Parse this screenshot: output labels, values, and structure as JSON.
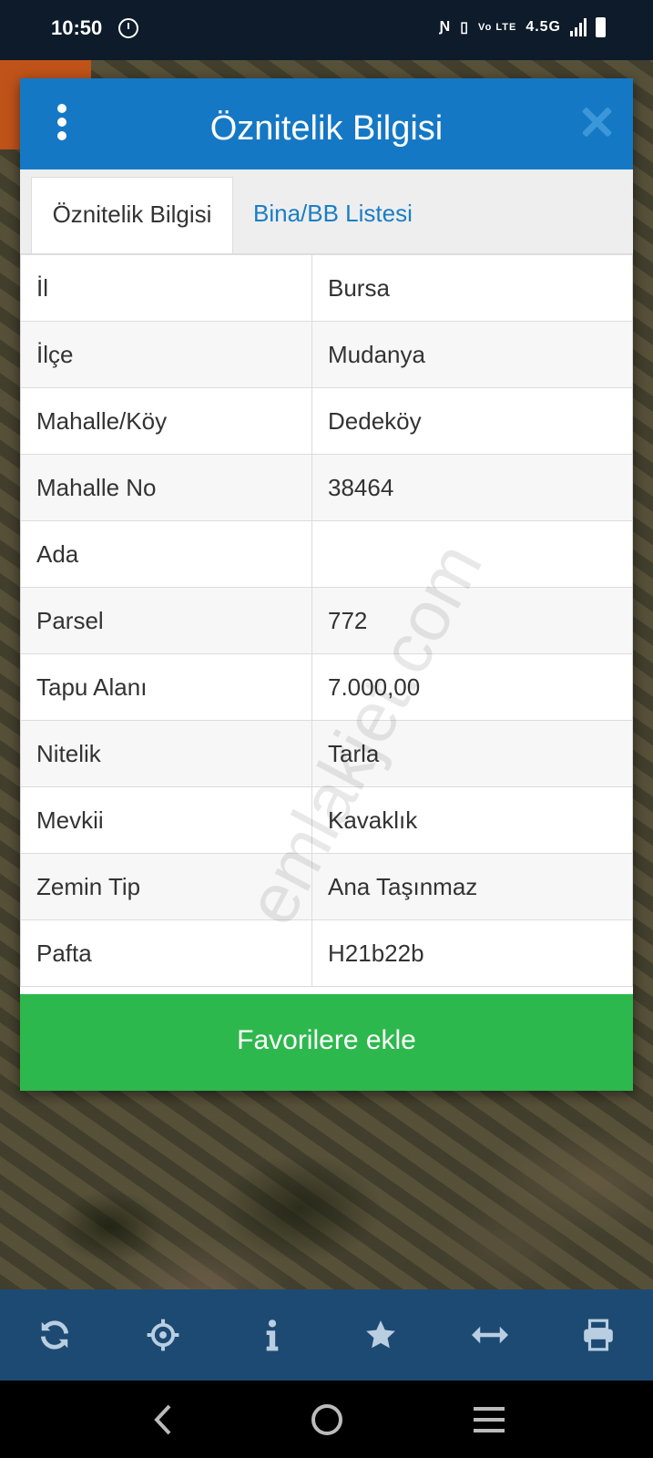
{
  "status": {
    "time": "10:50",
    "network": "4.5G",
    "volte": "Vo LTE"
  },
  "dialog": {
    "title": "Öznitelik Bilgisi",
    "tabs": [
      "Öznitelik Bilgisi",
      "Bina/BB Listesi"
    ],
    "rows": [
      {
        "key": "İl",
        "value": "Bursa"
      },
      {
        "key": "İlçe",
        "value": "Mudanya"
      },
      {
        "key": "Mahalle/Köy",
        "value": "Dedeköy"
      },
      {
        "key": "Mahalle No",
        "value": "38464"
      },
      {
        "key": "Ada",
        "value": ""
      },
      {
        "key": "Parsel",
        "value": "772"
      },
      {
        "key": "Tapu Alanı",
        "value": "7.000,00"
      },
      {
        "key": "Nitelik",
        "value": "Tarla"
      },
      {
        "key": "Mevkii",
        "value": "Kavaklık"
      },
      {
        "key": "Zemin Tip",
        "value": "Ana Taşınmaz"
      },
      {
        "key": "Pafta",
        "value": "H21b22b"
      }
    ],
    "favorite_label": "Favorilere ekle"
  },
  "watermark": "emlakjet.com",
  "toolbar": {
    "icons": [
      "refresh-icon",
      "locate-icon",
      "info-icon",
      "star-icon",
      "measure-icon",
      "print-icon"
    ]
  },
  "colors": {
    "header": "#1578c5",
    "favorite": "#2db84d",
    "toolbar": "#1d4a73",
    "accent_orange": "#c0531a"
  }
}
